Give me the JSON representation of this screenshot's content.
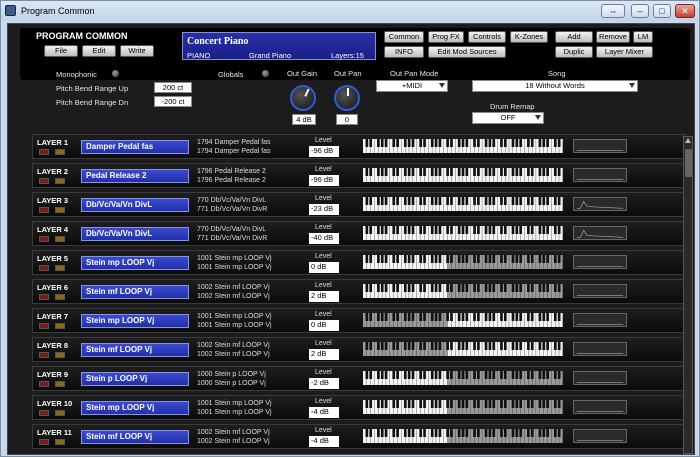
{
  "window": {
    "title": "Program Common"
  },
  "header": {
    "title": "PROGRAM COMMON",
    "buttons": [
      "File",
      "Edit",
      "Write"
    ]
  },
  "lcd": {
    "program": "Concert Piano",
    "category": "PIANO",
    "subcategory": "Grand Piano",
    "layers": "Layers:15"
  },
  "toolbar": {
    "row1": [
      "Common",
      "Prog FX",
      "Controls",
      "K-Zones"
    ],
    "row2": [
      "INFO",
      "Edit Mod Sources"
    ],
    "right_row1": [
      "Add",
      "Remove",
      "LM"
    ],
    "right_row2": [
      "Duplic",
      "Layer Mixer"
    ]
  },
  "controls": {
    "monophonic": "Monophonic",
    "pb_up_label": "Pitch Bend Range Up",
    "pb_up": "200 ct",
    "pb_dn_label": "Pitch Bend Range Dn",
    "pb_dn": "-200 ct",
    "globals": "Globals",
    "out_gain_label": "Out Gain",
    "out_gain": "4 dB",
    "out_pan_label": "Out Pan",
    "out_pan": "0",
    "out_pan_mode_label": "Out Pan Mode",
    "out_pan_mode": "+MIDI",
    "song_label": "Song",
    "song": "18 Without Words",
    "drum_remap_label": "Drum Remap",
    "drum_remap": "OFF"
  },
  "layer_level_label": "Level",
  "layers": [
    {
      "label": "LAYER 1",
      "program": "Damper Pedal fas",
      "key1": "1794 Damper Pedal fas",
      "key2": "1794 Damper Pedal fas",
      "level": "-96 dB",
      "zone": "full",
      "wave": "flat"
    },
    {
      "label": "LAYER 2",
      "program": "Pedal Release 2",
      "key1": "1796 Pedal Release 2",
      "key2": "1796 Pedal Release 2",
      "level": "-96 dB",
      "zone": "full",
      "wave": "flat"
    },
    {
      "label": "LAYER 3",
      "program": "Db/Vc/Va/Vn DivL",
      "key1": "770 Db/Vc/Va/Vn DivL",
      "key2": "771 Db/Vc/Va/Vn DivR",
      "level": "-23 dB",
      "zone": "full",
      "wave": "bump"
    },
    {
      "label": "LAYER 4",
      "program": "Db/Vc/Va/Vn DivL",
      "key1": "770 Db/Vc/Va/Vn DivL",
      "key2": "771 Db/Vc/Va/Vn DivR",
      "level": "-40 dB",
      "zone": "full",
      "wave": "bump"
    },
    {
      "label": "LAYER 5",
      "program": "Stein mp LOOP Vj",
      "key1": "1001 Stein mp LOOP Vj",
      "key2": "1001 Stein mp LOOP Vj",
      "level": "0 dB",
      "zone": "low",
      "wave": "flat"
    },
    {
      "label": "LAYER 6",
      "program": "Stein mf LOOP Vj",
      "key1": "1002 Stein mf LOOP Vj",
      "key2": "1002 Stein mf LOOP Vj",
      "level": "2 dB",
      "zone": "low",
      "wave": "flat"
    },
    {
      "label": "LAYER 7",
      "program": "Stein mp LOOP Vj",
      "key1": "1001 Stein mp LOOP Vj",
      "key2": "1001 Stein mp LOOP Vj",
      "level": "0 dB",
      "zone": "high",
      "wave": "flat"
    },
    {
      "label": "LAYER 8",
      "program": "Stein mf LOOP Vj",
      "key1": "1002 Stein mf LOOP Vj",
      "key2": "1002 Stein mf LOOP Vj",
      "level": "2 dB",
      "zone": "high",
      "wave": "flat"
    },
    {
      "label": "LAYER 9",
      "program": "Stein p LOOP Vj",
      "key1": "1000 Stein p LOOP Vj",
      "key2": "1000 Stein p LOOP Vj",
      "level": "-2 dB",
      "zone": "low",
      "wave": "flat"
    },
    {
      "label": "LAYER 10",
      "program": "Stein mp LOOP Vj",
      "key1": "1001 Stein mp LOOP Vj",
      "key2": "1001 Stein mp LOOP Vj",
      "level": "-4 dB",
      "zone": "low",
      "wave": "flat"
    },
    {
      "label": "LAYER 11",
      "program": "Stein mf LOOP Vj",
      "key1": "1002 Stein mf LOOP Vj",
      "key2": "1002 Stein mf LOOP Vj",
      "level": "-4 dB",
      "zone": "low",
      "wave": "flat"
    }
  ]
}
